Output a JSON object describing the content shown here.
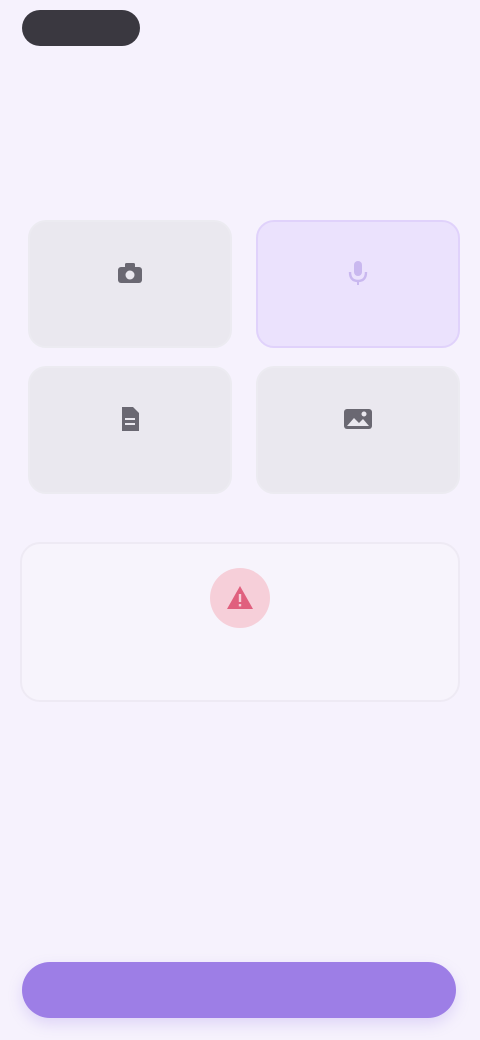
{
  "header": {
    "title": "",
    "subtitle": ""
  },
  "options": [
    {
      "label": "",
      "icon": "camera-icon",
      "selected": false
    },
    {
      "label": "",
      "icon": "microphone-icon",
      "selected": true
    },
    {
      "label": "",
      "icon": "document-icon",
      "selected": false
    },
    {
      "label": "",
      "icon": "image-icon",
      "selected": false
    }
  ],
  "notice": {
    "icon": "warning-icon",
    "message": ""
  },
  "primary_button": {
    "label": ""
  },
  "colors": {
    "accent": "#9d7ee6",
    "selected_card": "#ebe2fd",
    "card": "#eae8ef",
    "warning": "#e0607e",
    "background": "#f6f2fd"
  }
}
